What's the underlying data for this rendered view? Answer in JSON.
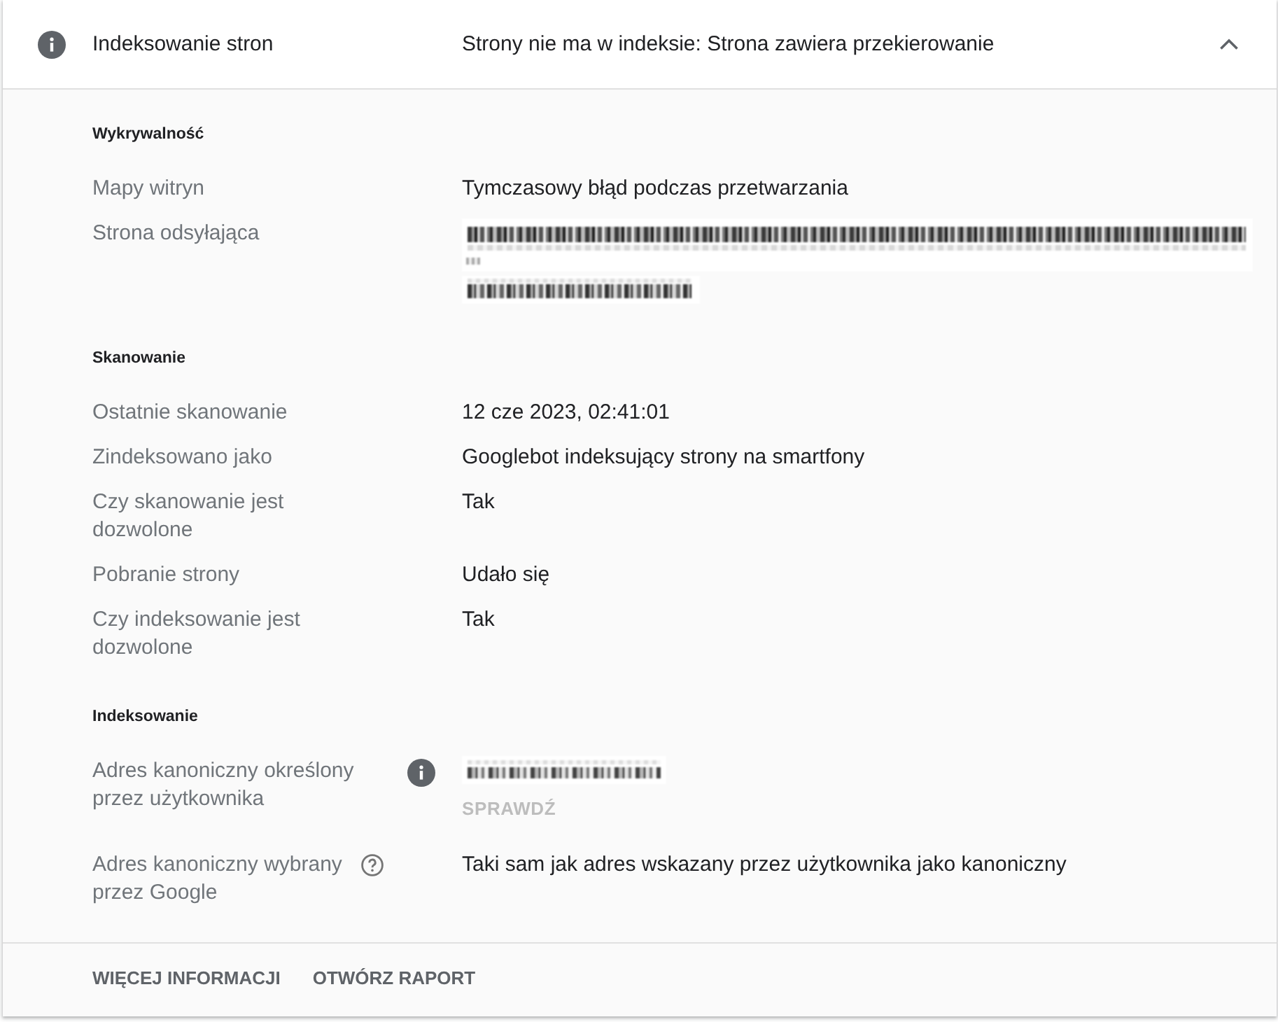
{
  "panel": {
    "title": "Indeksowanie stron",
    "status": "Strony nie ma w indeksie: Strona zawiera przekierowanie",
    "expanded": true
  },
  "sections": [
    {
      "title": "Wykrywalność",
      "rows": [
        {
          "kind": "text",
          "label": "Mapy witryn",
          "value": "Tymczasowy błąd podczas przetwarzania"
        },
        {
          "kind": "redacted_long",
          "label": "Strona odsyłająca"
        }
      ]
    },
    {
      "title": "Skanowanie",
      "rows": [
        {
          "kind": "text",
          "label": "Ostatnie skanowanie",
          "value": "12 cze 2023, 02:41:01"
        },
        {
          "kind": "text",
          "label": "Zindeksowano jako",
          "value": "Googlebot indeksujący strony na smartfony"
        },
        {
          "kind": "text",
          "label": "Czy skanowanie jest dozwolone",
          "value": "Tak"
        },
        {
          "kind": "text",
          "label": "Pobranie strony",
          "value": "Udało się"
        },
        {
          "kind": "text",
          "label": "Czy indeksowanie jest dozwolone",
          "value": "Tak"
        }
      ]
    },
    {
      "title": "Indeksowanie",
      "rows": [
        {
          "kind": "redacted_short",
          "label": "Adres kanoniczny określony przez użytkownika",
          "hint": {
            "kind": "info"
          },
          "action": {
            "label": "SPRAWDŹ",
            "disabled": true
          }
        },
        {
          "kind": "text",
          "label": "Adres kanoniczny wybrany przez Google",
          "hint": {
            "kind": "help"
          },
          "value": "Taki sam jak adres wskazany przez użytkownika jako kanoniczny"
        }
      ]
    }
  ],
  "footer_actions": [
    {
      "label": "WIĘCEJ INFORMACJI"
    },
    {
      "label": "OTWÓRZ RAPORT"
    }
  ]
}
